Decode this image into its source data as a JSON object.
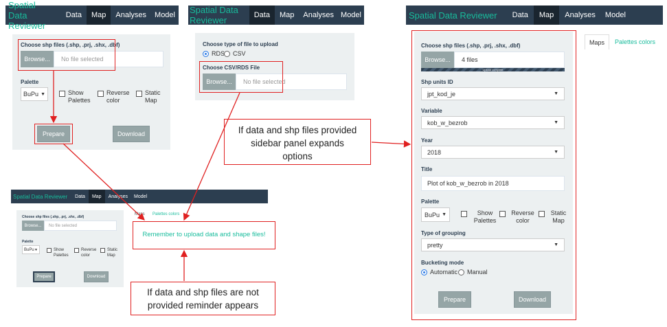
{
  "app": {
    "brand": "Spatial Data Reviewer",
    "nav": [
      "Data",
      "Map",
      "Analyses",
      "Model"
    ],
    "active_nav": "Map"
  },
  "panel1": {
    "shp_label": "Choose shp files (.shp, .prj, .shx, .dbf)",
    "browse": "Browse...",
    "file_placeholder": "No file selected",
    "palette_label": "Palette",
    "palette_value": "BuPu",
    "checkboxes": [
      "Show Palettes",
      "Reverse color",
      "Static Map"
    ],
    "prepare": "Prepare",
    "download": "Download"
  },
  "panel2": {
    "type_label": "Choose type of file to upload",
    "radio_options": [
      "RDS",
      "CSV"
    ],
    "radio_selected": "RDS",
    "csv_label": "Choose CSV/RDS File",
    "browse": "Browse...",
    "file_placeholder": "No file selected"
  },
  "panel3": {
    "shp_label": "Choose shp files (.shp, .prj, .shx, .dbf)",
    "browse": "Browse...",
    "file_placeholder": "No file selected",
    "palette_label": "Palette",
    "palette_value": "BuPu",
    "checkboxes": [
      "Show Palettes",
      "Reverse color",
      "Static Map"
    ],
    "prepare": "Prepare",
    "download": "Download",
    "tabs": [
      "Maps",
      "Palettes colors"
    ],
    "reminder": "Remember to upload data and shape files!"
  },
  "panel4": {
    "shp_label": "Choose shp files (.shp, .prj, .shx, .dbf)",
    "browse": "Browse...",
    "files_value": "4 files",
    "upload_status": "Upload complete",
    "upload_progress": 1.0,
    "units_label": "Shp units ID",
    "units_value": "jpt_kod_je",
    "variable_label": "Variable",
    "variable_value": "kob_w_bezrob",
    "year_label": "Year",
    "year_value": "2018",
    "title_label": "Title",
    "title_value": "Plot of kob_w_bezrob in 2018",
    "palette_label": "Palette",
    "palette_value": "BuPu",
    "checkboxes": [
      "Show Palettes",
      "Reverse color",
      "Static Map"
    ],
    "grouping_label": "Type of grouping",
    "grouping_value": "pretty",
    "bucketing_label": "Bucketing mode",
    "bucketing_options": [
      "Automatic",
      "Manual"
    ],
    "bucketing_selected": "Automatic",
    "prepare": "Prepare",
    "download": "Download",
    "tabs": [
      "Maps",
      "Palettes colors"
    ]
  },
  "annotations": {
    "expand_note_lines": [
      "If data and shp files provided",
      "sidebar panel expands",
      "options"
    ],
    "reminder_note_lines": [
      "If data and shp files are not",
      "provided reminder appears"
    ]
  },
  "colors": {
    "navbar": "#2c3e50",
    "brand": "#18bc9c",
    "well": "#ecf0f1",
    "button": "#95a5a6",
    "highlight": "#e02020"
  }
}
